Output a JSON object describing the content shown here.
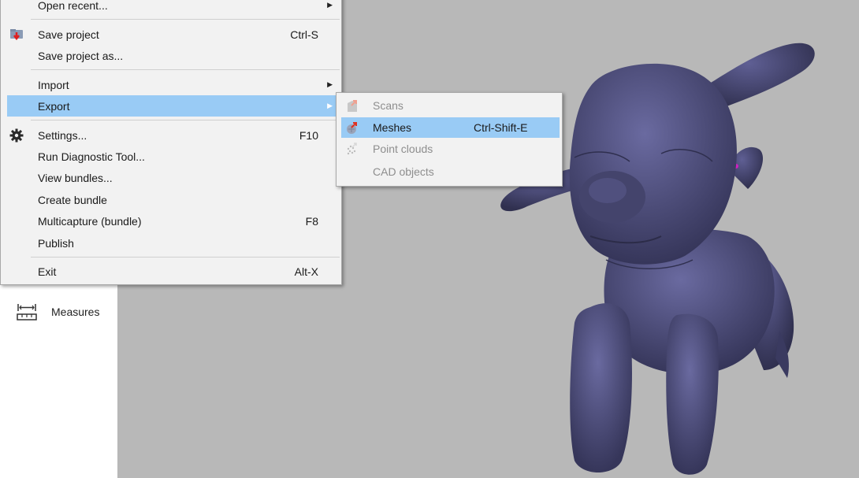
{
  "left_panel": {
    "measures_label": "Measures"
  },
  "file_menu": {
    "items": [
      {
        "label": "Open recent...",
        "shortcut": "",
        "submenu": true
      },
      {
        "label": "Save project",
        "shortcut": "Ctrl-S"
      },
      {
        "label": "Save project as..."
      },
      {
        "label": "Import",
        "submenu": true
      },
      {
        "label": "Export",
        "submenu": true,
        "highlighted": true
      },
      {
        "label": "Settings...",
        "shortcut": "F10"
      },
      {
        "label": "Run Diagnostic Tool..."
      },
      {
        "label": "View bundles..."
      },
      {
        "label": "Create bundle"
      },
      {
        "label": "Multicapture (bundle)",
        "shortcut": "F8"
      },
      {
        "label": "Publish"
      },
      {
        "label": "Exit",
        "shortcut": "Alt-X"
      }
    ]
  },
  "export_submenu": {
    "items": [
      {
        "label": "Scans",
        "enabled": false
      },
      {
        "label": "Meshes",
        "shortcut": "Ctrl-Shift-E",
        "enabled": true,
        "highlighted": true
      },
      {
        "label": "Point clouds",
        "enabled": false
      },
      {
        "label": "CAD objects",
        "enabled": false
      }
    ]
  },
  "colors": {
    "highlight": "#99cbf5",
    "viewport_bg": "#b8b8b8",
    "model": "#4a4a72",
    "menu_bg": "#f2f2f2"
  },
  "icons": {
    "save_project": "save-folder-icon",
    "settings": "gear-icon",
    "measures": "ruler-icon",
    "scans": "export-scans-icon",
    "meshes": "export-meshes-icon",
    "point_clouds": "export-point-clouds-icon"
  }
}
